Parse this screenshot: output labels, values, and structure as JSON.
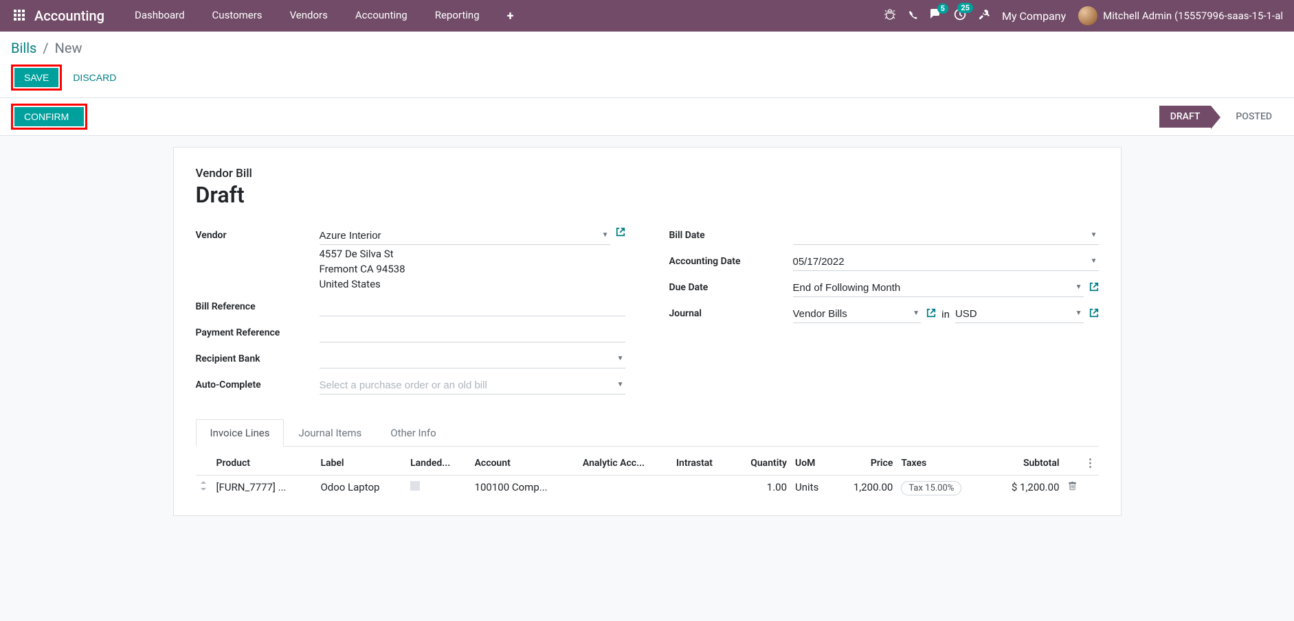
{
  "nav": {
    "brand": "Accounting",
    "items": [
      "Dashboard",
      "Customers",
      "Vendors",
      "Accounting",
      "Reporting"
    ],
    "badges": {
      "messages": "5",
      "activities": "25"
    },
    "company": "My Company",
    "user": "Mitchell Admin (15557996-saas-15-1-al"
  },
  "breadcrumb": {
    "root": "Bills",
    "current": "New"
  },
  "buttons": {
    "save": "SAVE",
    "discard": "DISCARD",
    "confirm": "CONFIRM"
  },
  "status": {
    "draft": "DRAFT",
    "posted": "POSTED"
  },
  "form": {
    "subtitle": "Vendor Bill",
    "title": "Draft",
    "left": {
      "vendor_label": "Vendor",
      "vendor_value": "Azure Interior",
      "vendor_addr1": "4557 De Silva St",
      "vendor_addr2": "Fremont CA 94538",
      "vendor_addr3": "United States",
      "bill_ref_label": "Bill Reference",
      "bill_ref_value": "",
      "pay_ref_label": "Payment Reference",
      "pay_ref_value": "",
      "bank_label": "Recipient Bank",
      "bank_value": "",
      "auto_label": "Auto-Complete",
      "auto_placeholder": "Select a purchase order or an old bill"
    },
    "right": {
      "bill_date_label": "Bill Date",
      "bill_date_value": "",
      "acct_date_label": "Accounting Date",
      "acct_date_value": "05/17/2022",
      "due_label": "Due Date",
      "due_value": "End of Following Month",
      "journal_label": "Journal",
      "journal_value": "Vendor Bills",
      "journal_in": "in",
      "currency_value": "USD"
    }
  },
  "tabs": {
    "t1": "Invoice Lines",
    "t2": "Journal Items",
    "t3": "Other Info"
  },
  "table": {
    "headers": {
      "product": "Product",
      "label": "Label",
      "landed": "Landed...",
      "account": "Account",
      "analytic": "Analytic Acc...",
      "intrastat": "Intrastat",
      "qty": "Quantity",
      "uom": "UoM",
      "price": "Price",
      "taxes": "Taxes",
      "subtotal": "Subtotal"
    },
    "row": {
      "product": "[FURN_7777] ...",
      "label": "Odoo Laptop",
      "account": "100100 Comp...",
      "qty": "1.00",
      "uom": "Units",
      "price": "1,200.00",
      "tax": "Tax 15.00%",
      "subtotal": "$ 1,200.00"
    }
  }
}
